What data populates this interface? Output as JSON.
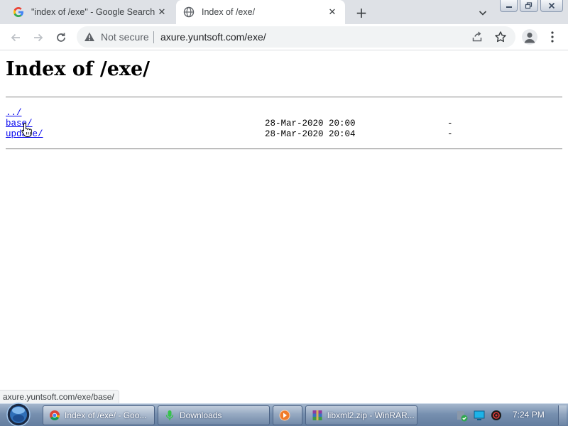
{
  "browser": {
    "tabs": [
      {
        "title": "\"index of /exe\" - Google Search",
        "favicon": "google-g-icon",
        "active": false
      },
      {
        "title": "Index of /exe/",
        "favicon": "globe-icon",
        "active": true
      }
    ],
    "new_tab_symbol": "+",
    "close_symbol": "✕"
  },
  "toolbar": {
    "security_label": "Not secure",
    "url": "axure.yuntsoft.com/exe/"
  },
  "page": {
    "heading": "Index of /exe/",
    "entries": [
      {
        "name": "../",
        "date": "",
        "size": ""
      },
      {
        "name": "base/",
        "date": "28-Mar-2020 20:00",
        "size": "-"
      },
      {
        "name": "update/",
        "date": "28-Mar-2020 20:04",
        "size": "-"
      }
    ]
  },
  "status_bubble": "axure.yuntsoft.com/exe/base/",
  "taskbar": {
    "items": [
      {
        "label": "Index of /exe/ - Goo...",
        "icon": "chrome-icon",
        "active": true
      },
      {
        "label": "Downloads",
        "icon": "microphone-icon",
        "active": false
      },
      {
        "label": "",
        "icon": "media-player-icon",
        "active": false
      },
      {
        "label": "libxml2.zip - WinRAR...",
        "icon": "winrar-icon",
        "active": false
      }
    ],
    "clock": "7:24 PM"
  },
  "colors": {
    "link": "#0000ee",
    "tabstrip": "#dee1e6",
    "omnibox": "#f1f3f4",
    "taskbar": "#7790b0"
  }
}
